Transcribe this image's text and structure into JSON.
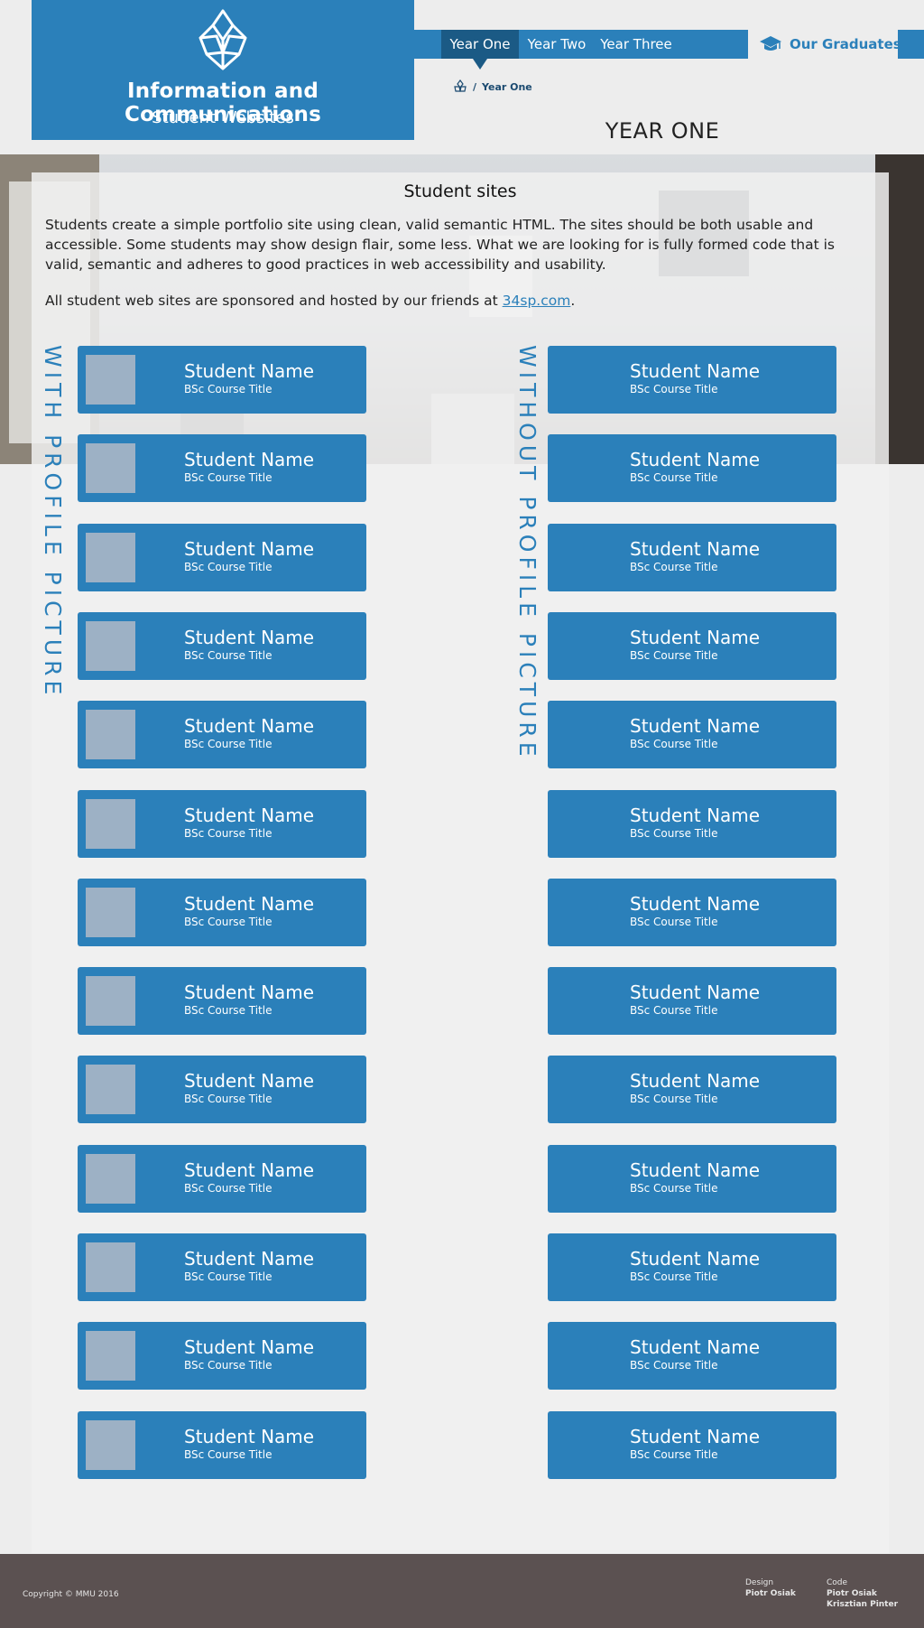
{
  "header": {
    "title": "Information and Communications",
    "subtitle": "Student Websites",
    "logo_icon": "triangle-knot-logo-icon"
  },
  "nav": {
    "tabs": [
      {
        "label": "Year One",
        "active": true
      },
      {
        "label": "Year Two",
        "active": false
      },
      {
        "label": "Year Three",
        "active": false
      }
    ],
    "graduates_label": "Our Graduates",
    "graduates_icon": "graduation-cap-icon"
  },
  "breadcrumb": {
    "separator": "/",
    "current": "Year One",
    "home_icon": "home-logo-icon"
  },
  "page": {
    "heading": "YEAR ONE"
  },
  "section": {
    "title": "Student sites",
    "intro": "Students create a simple portfolio site using clean, valid semantic HTML. The sites should be both usable and accessible. Some students may show design flair, some less. What we are looking for is fully formed code that is valid, semantic and adheres to good practices in web accessibility and usability.",
    "sponsor_prefix": "All student web sites are sponsored and hosted by our friends at ",
    "sponsor_link": "34sp.com",
    "sponsor_suffix": "."
  },
  "columns": {
    "with_label": "WITH PROFILE PICTURE",
    "without_label": "WITHOUT PROFILE PICTURE"
  },
  "students_with_picture": [
    {
      "name": "Student Name",
      "course": "BSc Course Title"
    },
    {
      "name": "Student Name",
      "course": "BSc Course Title"
    },
    {
      "name": "Student Name",
      "course": "BSc Course Title"
    },
    {
      "name": "Student Name",
      "course": "BSc Course Title"
    },
    {
      "name": "Student Name",
      "course": "BSc Course Title"
    },
    {
      "name": "Student Name",
      "course": "BSc Course Title"
    },
    {
      "name": "Student Name",
      "course": "BSc Course Title"
    },
    {
      "name": "Student Name",
      "course": "BSc Course Title"
    },
    {
      "name": "Student Name",
      "course": "BSc Course Title"
    },
    {
      "name": "Student Name",
      "course": "BSc Course Title"
    },
    {
      "name": "Student Name",
      "course": "BSc Course Title"
    },
    {
      "name": "Student Name",
      "course": "BSc Course Title"
    },
    {
      "name": "Student Name",
      "course": "BSc Course Title"
    }
  ],
  "students_without_picture": [
    {
      "name": "Student Name",
      "course": "BSc Course Title"
    },
    {
      "name": "Student Name",
      "course": "BSc Course Title"
    },
    {
      "name": "Student Name",
      "course": "BSc Course Title"
    },
    {
      "name": "Student Name",
      "course": "BSc Course Title"
    },
    {
      "name": "Student Name",
      "course": "BSc Course Title"
    },
    {
      "name": "Student Name",
      "course": "BSc Course Title"
    },
    {
      "name": "Student Name",
      "course": "BSc Course Title"
    },
    {
      "name": "Student Name",
      "course": "BSc Course Title"
    },
    {
      "name": "Student Name",
      "course": "BSc Course Title"
    },
    {
      "name": "Student Name",
      "course": "BSc Course Title"
    },
    {
      "name": "Student Name",
      "course": "BSc Course Title"
    },
    {
      "name": "Student Name",
      "course": "BSc Course Title"
    },
    {
      "name": "Student Name",
      "course": "BSc Course Title"
    }
  ],
  "footer": {
    "copyright": "Copyright © MMU 2016",
    "design_title": "Design",
    "design_names": [
      "Piotr Osiak"
    ],
    "code_title": "Code",
    "code_names": [
      "Piotr Osiak",
      "Krisztian Pinter"
    ]
  },
  "colors": {
    "brand_blue": "#2b80ba",
    "active_tab": "#1b5a85",
    "thumbnail": "#9db1c5",
    "footer_bg": "#5b5151",
    "page_bg": "#ededed"
  }
}
